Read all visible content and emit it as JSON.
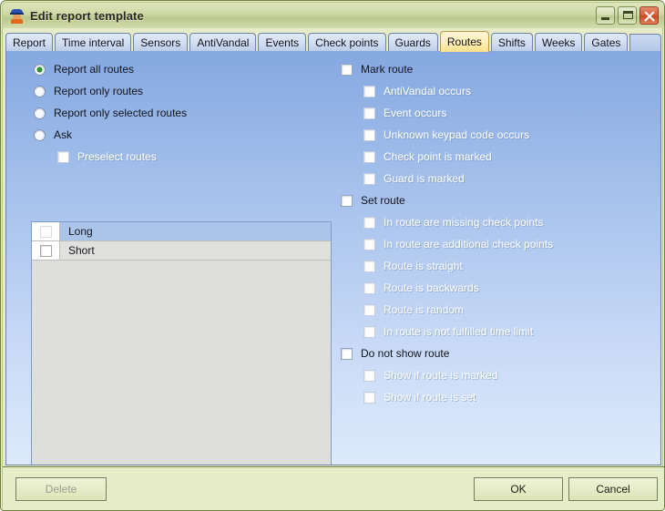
{
  "window": {
    "title": "Edit report template",
    "icon": "guard-person-icon",
    "frame_color": "#6f8040",
    "titlebar_color": "#cfd9a6",
    "body_gradient_top": "#85a8e1",
    "body_gradient_bottom": "#dceafb",
    "controls": [
      {
        "name": "minimize-button",
        "glyph": "_"
      },
      {
        "name": "maximize-button",
        "glyph": "□"
      },
      {
        "name": "close-button",
        "glyph": "✕"
      }
    ]
  },
  "tabs": {
    "selected": "Routes",
    "selected_color": "#ffeeb4",
    "items": [
      {
        "label": "Report"
      },
      {
        "label": "Time interval"
      },
      {
        "label": "Sensors"
      },
      {
        "label": "AntiVandal"
      },
      {
        "label": "Events"
      },
      {
        "label": "Check points"
      },
      {
        "label": "Guards"
      },
      {
        "label": "Routes"
      },
      {
        "label": "Shifts"
      },
      {
        "label": "Weeks"
      },
      {
        "label": "Gates"
      }
    ]
  },
  "routes_panel": {
    "mode_radios": [
      {
        "label": "Report all routes",
        "checked": true,
        "enabled": true
      },
      {
        "label": "Report only routes",
        "checked": false,
        "enabled": true
      },
      {
        "label": "Report only selected routes",
        "checked": false,
        "enabled": true
      },
      {
        "label": "Ask",
        "checked": false,
        "enabled": true
      }
    ],
    "preselect": {
      "label": "Preselect routes",
      "checked": false,
      "enabled": false
    },
    "route_list": {
      "rows": [
        {
          "label": "Long",
          "checked": false,
          "selected": true
        },
        {
          "label": "Short",
          "checked": false,
          "selected": false
        }
      ]
    },
    "mark_route": {
      "label": "Mark route",
      "checked": false,
      "enabled": true,
      "children": [
        {
          "label": "AntiVandal occurs",
          "checked": false,
          "enabled": false
        },
        {
          "label": "Event occurs",
          "checked": false,
          "enabled": false
        },
        {
          "label": "Unknown keypad code occurs",
          "checked": false,
          "enabled": false
        },
        {
          "label": "Check point is marked",
          "checked": false,
          "enabled": false
        },
        {
          "label": "Guard is marked",
          "checked": false,
          "enabled": false
        }
      ]
    },
    "set_route": {
      "label": "Set route",
      "checked": false,
      "enabled": true,
      "children": [
        {
          "label": "In route are missing check points",
          "checked": false,
          "enabled": false
        },
        {
          "label": "In route are additional check points",
          "checked": false,
          "enabled": false
        },
        {
          "label": "Route is straight",
          "checked": false,
          "enabled": false
        },
        {
          "label": "Route is backwards",
          "checked": false,
          "enabled": false
        },
        {
          "label": "Route is random",
          "checked": false,
          "enabled": false
        },
        {
          "label": "In route is not fulfilled time limit",
          "checked": false,
          "enabled": false
        }
      ]
    },
    "do_not_show_route": {
      "label": "Do not show route",
      "checked": false,
      "enabled": true,
      "children": [
        {
          "label": "Show if route is marked",
          "checked": false,
          "enabled": false
        },
        {
          "label": "Show if route is set",
          "checked": false,
          "enabled": false
        }
      ]
    }
  },
  "footer": {
    "delete_label": "Delete",
    "delete_enabled": false,
    "ok_label": "OK",
    "cancel_label": "Cancel"
  }
}
